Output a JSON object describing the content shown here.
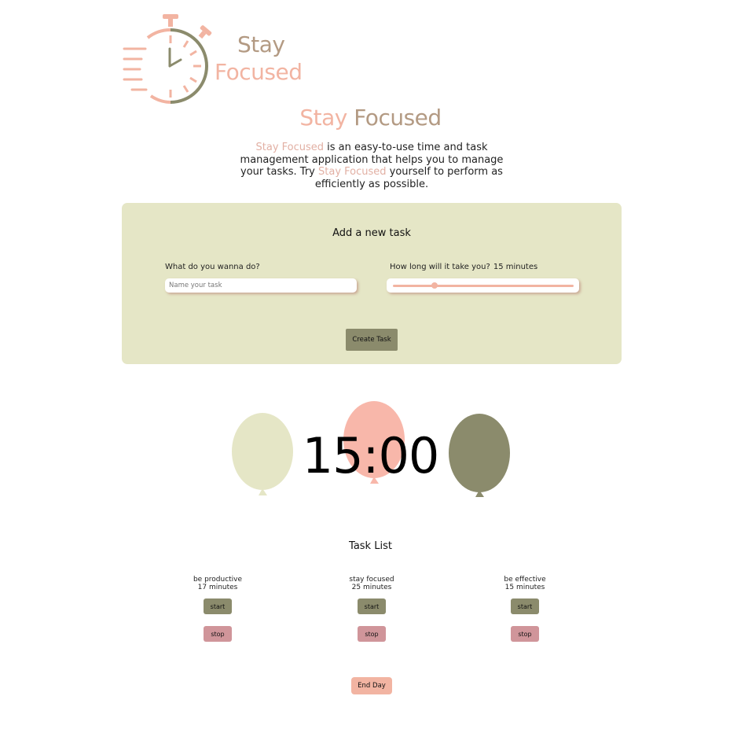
{
  "brand": {
    "logo_line1": "Stay",
    "logo_line2": "Focused",
    "colors": {
      "tan": "#b39a83",
      "pink": "#f2b4a2",
      "olive": "#8b8b6c",
      "pale": "#e5e6c6",
      "rose": "#d0959a"
    }
  },
  "heading": {
    "part1": "Stay",
    "part2": "Focused"
  },
  "intro": {
    "brand_a": "Stay Focused",
    "text_a": " is an easy-to-use time and task management application that helps you to manage your tasks. Try ",
    "brand_b": "Stay Focused",
    "text_b": " yourself to perform as efficiently as possible."
  },
  "form": {
    "title": "Add a new task",
    "name_label": "What do you wanna do?",
    "name_placeholder": "Name your task",
    "name_value": "",
    "duration_label": "How long will it take you?",
    "duration_value": "15 minutes",
    "slider_fraction": 0.23,
    "create_label": "Create Task"
  },
  "timer": {
    "display": "15:00",
    "balloons": [
      "pale",
      "pink",
      "olive"
    ]
  },
  "task_list": {
    "title": "Task List",
    "tasks": [
      {
        "name": "be productive",
        "minutes": "17 minutes",
        "start": "start",
        "stop": "stop"
      },
      {
        "name": "stay focused",
        "minutes": "25 minutes",
        "start": "start",
        "stop": "stop"
      },
      {
        "name": "be effective",
        "minutes": "15 minutes",
        "start": "start",
        "stop": "stop"
      }
    ]
  },
  "end_day_label": "End Day"
}
